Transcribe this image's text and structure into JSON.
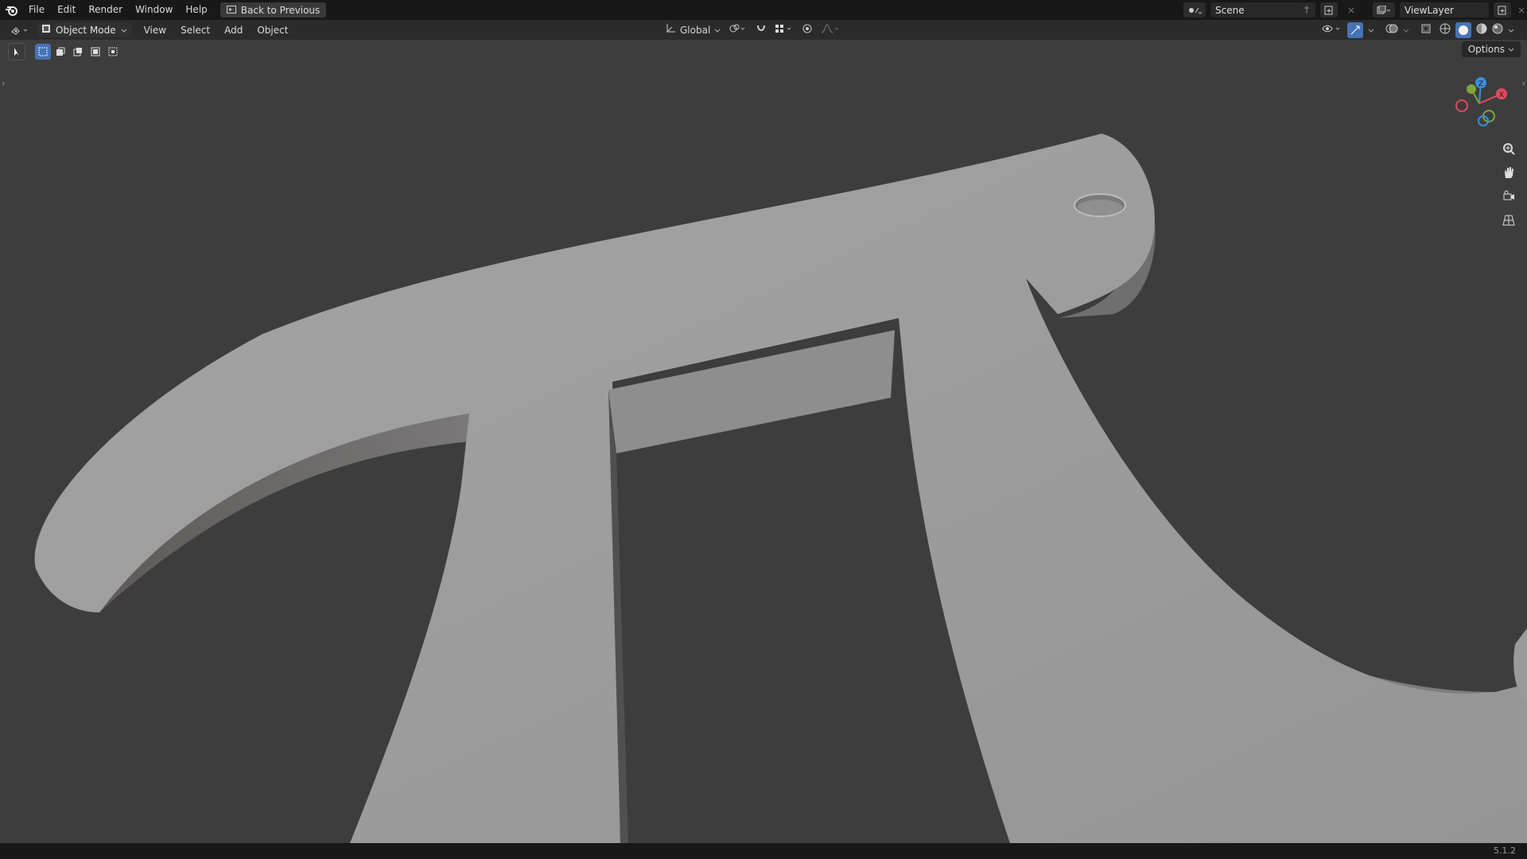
{
  "topbar": {
    "menus": [
      "File",
      "Edit",
      "Render",
      "Window",
      "Help"
    ],
    "back_label": "Back to Previous",
    "scene_label": "Scene",
    "viewlayer_label": "ViewLayer"
  },
  "header": {
    "mode_label": "Object Mode",
    "menus": [
      "View",
      "Select",
      "Add",
      "Object"
    ],
    "transform_orientation": "Global",
    "options_label": "Options"
  },
  "status": {
    "version": "5.1.2"
  },
  "colors": {
    "accent": "#4772b3",
    "axis_x": "#e04a5f",
    "axis_y": "#7ea63a",
    "axis_z": "#3b8ddf"
  }
}
